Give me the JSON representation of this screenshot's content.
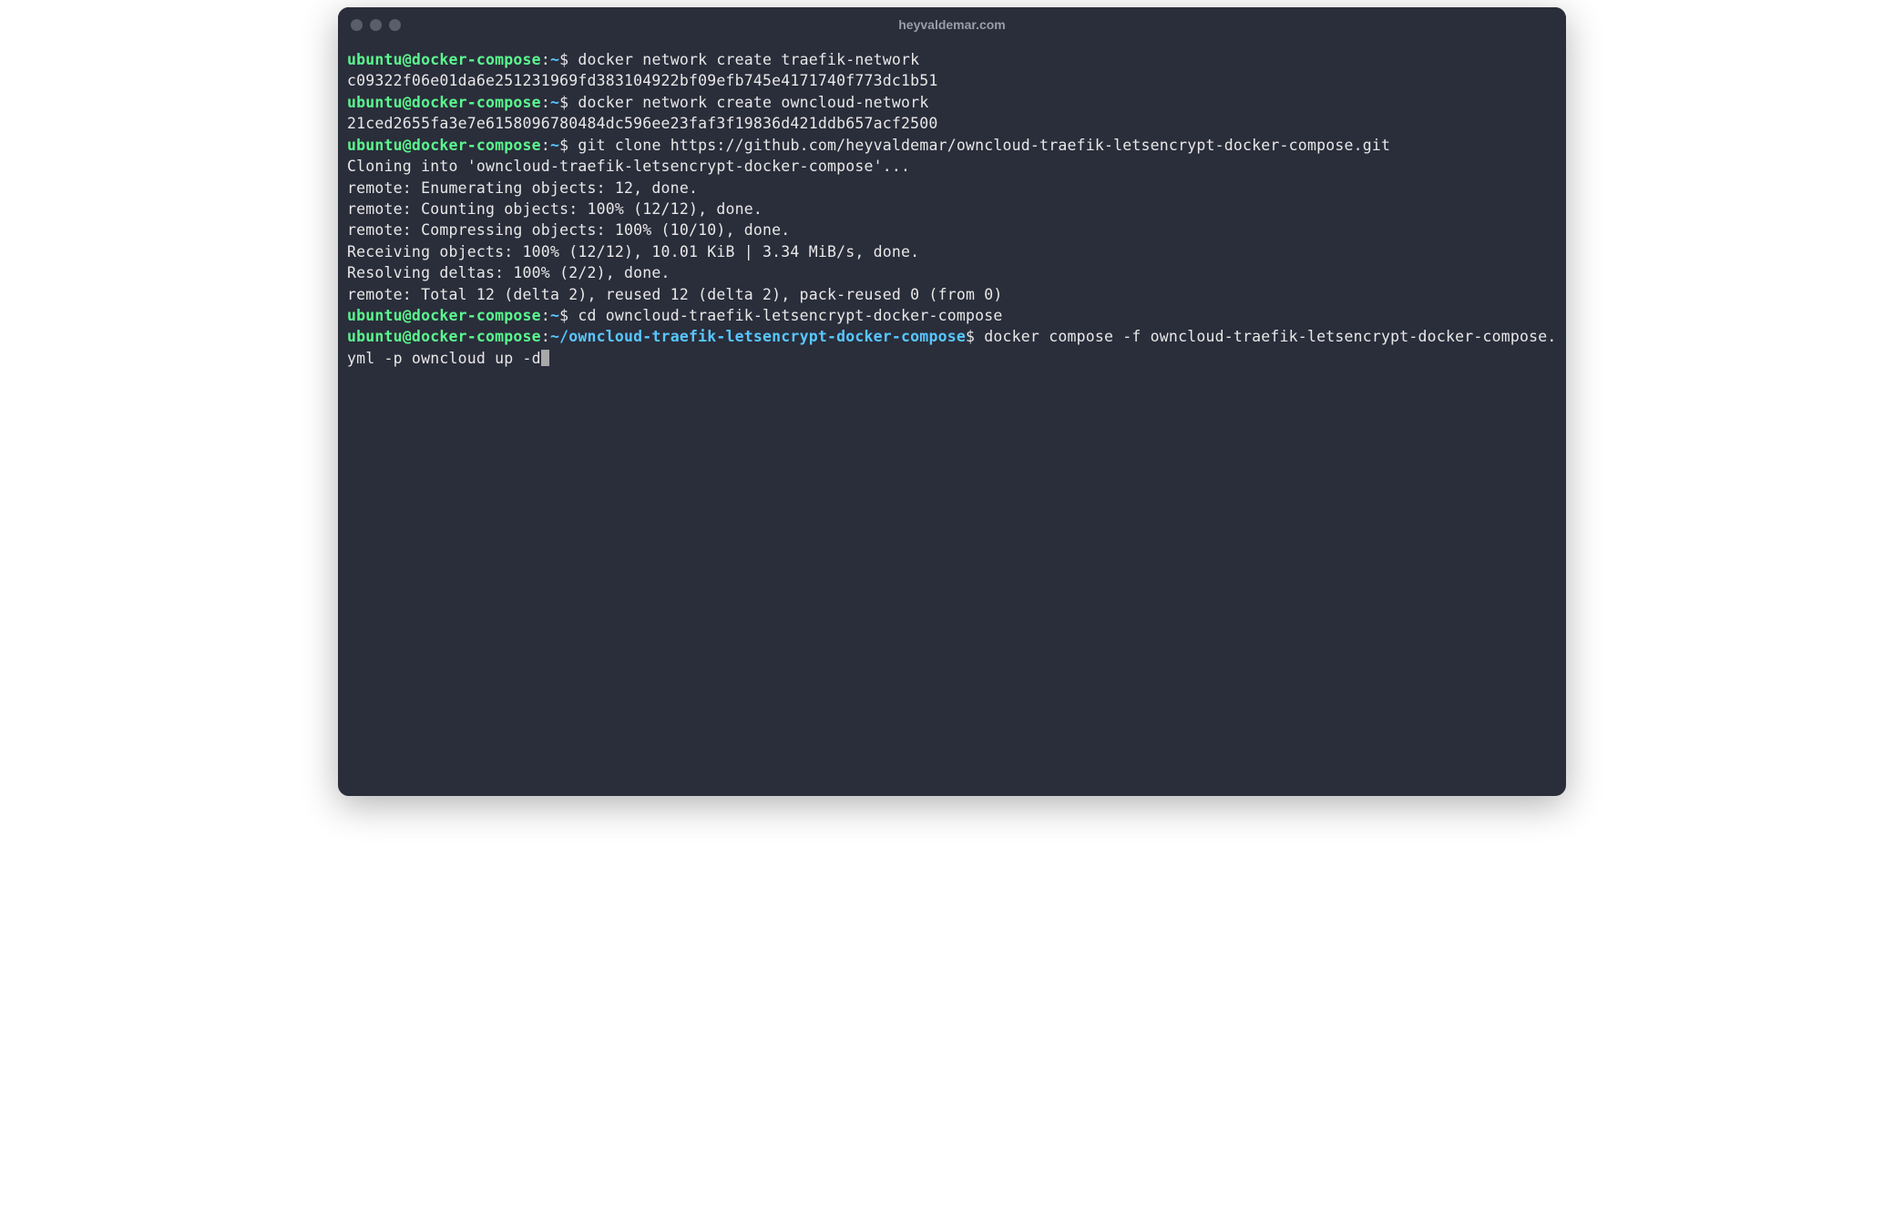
{
  "window": {
    "title": "heyvaldemar.com"
  },
  "prompt": {
    "user_host": "ubuntu@docker-compose",
    "colon": ":",
    "home_path": "~",
    "long_path": "~/owncloud-traefik-letsencrypt-docker-compose",
    "dollar": "$"
  },
  "lines": {
    "cmd1": " docker network create traefik-network",
    "out1": "c09322f06e01da6e251231969fd383104922bf09efb745e4171740f773dc1b51",
    "cmd2": " docker network create owncloud-network",
    "out2": "21ced2655fa3e7e6158096780484dc596ee23faf3f19836d421ddb657acf2500",
    "cmd3": " git clone https://github.com/heyvaldemar/owncloud-traefik-letsencrypt-docker-compose.git",
    "out3": "Cloning into 'owncloud-traefik-letsencrypt-docker-compose'...",
    "out4": "remote: Enumerating objects: 12, done.",
    "out5": "remote: Counting objects: 100% (12/12), done.",
    "out6": "remote: Compressing objects: 100% (10/10), done.",
    "out7": "Receiving objects: 100% (12/12), 10.01 KiB | 3.34 MiB/s, done.",
    "out8": "Resolving deltas: 100% (2/2), done.",
    "out9": "remote: Total 12 (delta 2), reused 12 (delta 2), pack-reused 0 (from 0)",
    "cmd4": " cd owncloud-traefik-letsencrypt-docker-compose",
    "cmd5": " docker compose -f owncloud-traefik-letsencrypt-docker-compose.yml -p owncloud up -d"
  }
}
